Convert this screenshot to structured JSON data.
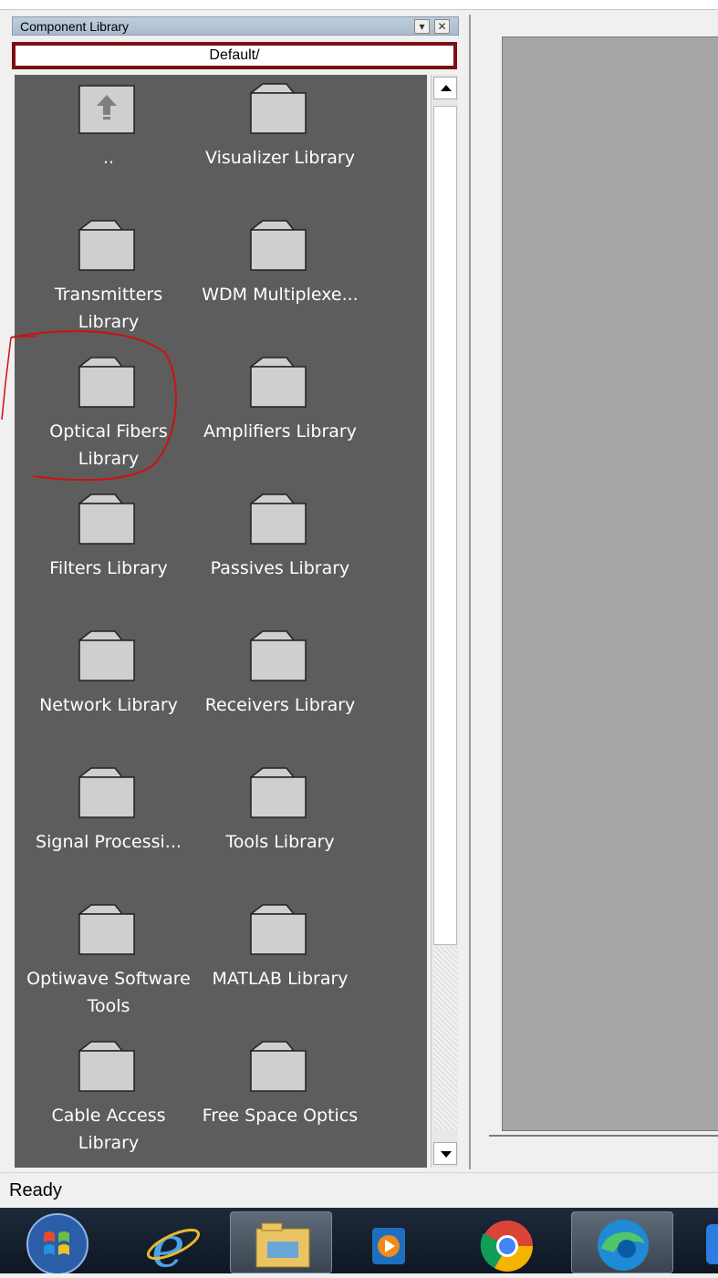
{
  "panel": {
    "title": "Component Library",
    "path": "Default/",
    "items": [
      {
        "label": "..",
        "icon": "parent-folder-icon"
      },
      {
        "label": "Visualizer Library",
        "icon": "folder-icon"
      },
      {
        "label": "Transmitters Library",
        "icon": "folder-icon"
      },
      {
        "label": "WDM Multiplexe...",
        "icon": "folder-icon"
      },
      {
        "label": "Optical Fibers Library",
        "icon": "folder-icon"
      },
      {
        "label": "Amplifiers Library",
        "icon": "folder-icon"
      },
      {
        "label": "Filters Library",
        "icon": "folder-icon"
      },
      {
        "label": "Passives Library",
        "icon": "folder-icon"
      },
      {
        "label": "Network Library",
        "icon": "folder-icon"
      },
      {
        "label": "Receivers Library",
        "icon": "folder-icon"
      },
      {
        "label": "Signal Processi...",
        "icon": "folder-icon"
      },
      {
        "label": "Tools Library",
        "icon": "folder-icon"
      },
      {
        "label": "Optiwave Software Tools",
        "icon": "folder-icon"
      },
      {
        "label": "MATLAB Library",
        "icon": "folder-icon"
      },
      {
        "label": "Cable Access Library",
        "icon": "folder-icon"
      },
      {
        "label": "Free Space Optics",
        "icon": "folder-icon"
      }
    ]
  },
  "status": {
    "text": "Ready"
  },
  "taskbar": {
    "items": [
      {
        "icon": "windows-start-icon"
      },
      {
        "icon": "internet-explorer-icon"
      },
      {
        "icon": "file-explorer-icon"
      },
      {
        "icon": "media-player-icon"
      },
      {
        "icon": "chrome-icon"
      },
      {
        "icon": "edge-icon"
      }
    ]
  },
  "colors": {
    "content_bg": "#5d5d5d",
    "path_border": "#7b0f12",
    "annotation": "#d01010",
    "canvas_bg": "#a6a6a6"
  }
}
